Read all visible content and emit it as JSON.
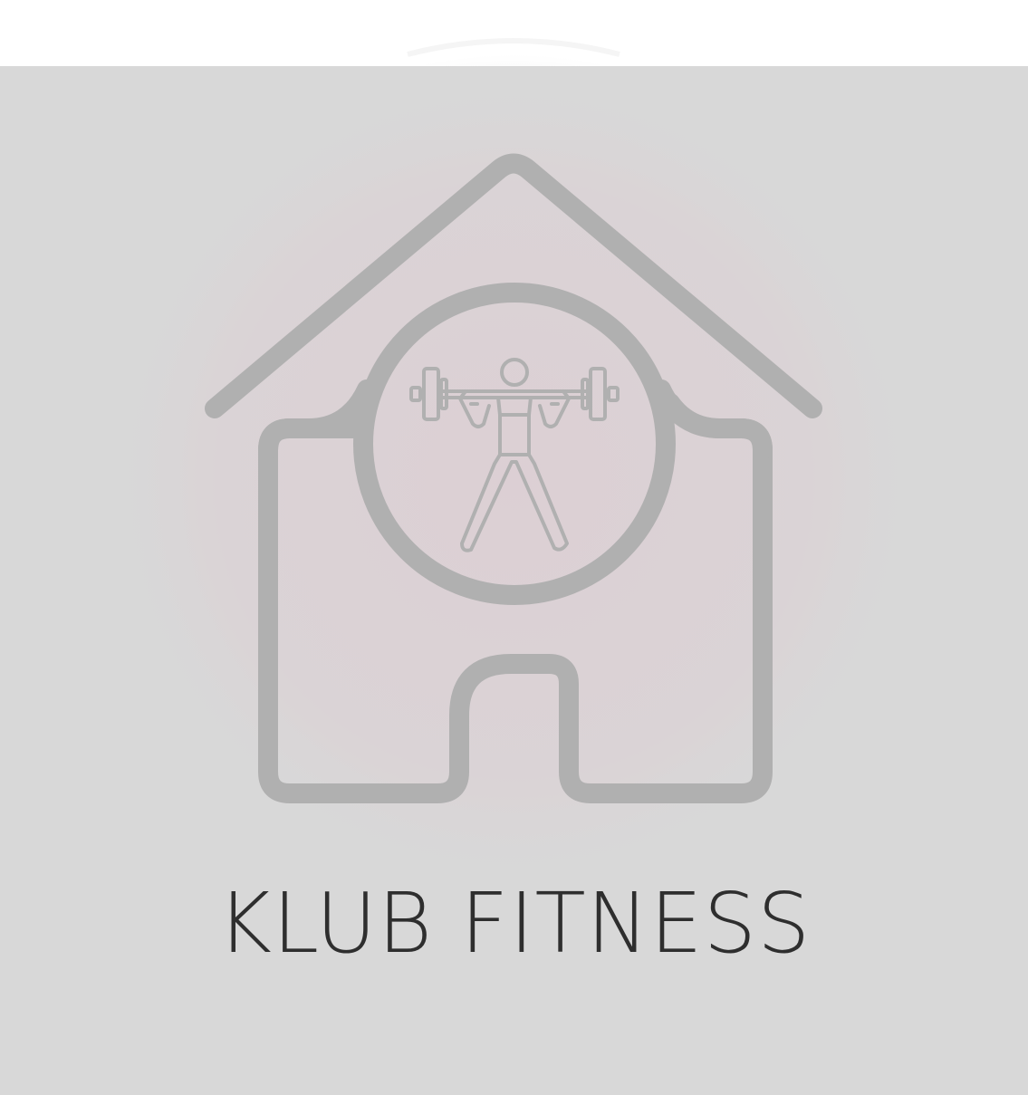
{
  "brand": {
    "name": "KLUB FITNESS"
  },
  "logo": {
    "icon": "house-weightlifter-icon"
  },
  "colors": {
    "background": "#d8d8d8",
    "page": "#ffffff",
    "logo_stroke": "#b0b0b0",
    "text": "#2e2e2e",
    "glow": "#dccfd4"
  }
}
